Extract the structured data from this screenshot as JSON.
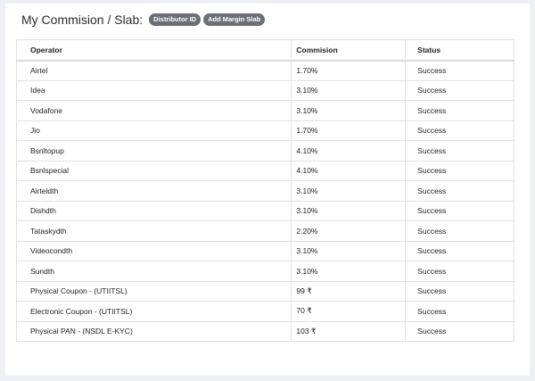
{
  "header": {
    "title": "My Commision / Slab:",
    "badges": [
      "Distributor ID",
      "Add Margin Slab"
    ]
  },
  "table": {
    "columns": [
      "Operator",
      "Commision",
      "Status"
    ],
    "rows": [
      [
        "Airtel",
        "1.70%",
        "Success"
      ],
      [
        "Idea",
        "3.10%",
        "Success"
      ],
      [
        "Vodafone",
        "3.10%",
        "Success"
      ],
      [
        "Jio",
        "1.70%",
        "Success"
      ],
      [
        "Bsnltopup",
        "4.10%",
        "Success"
      ],
      [
        "Bsnlspecial",
        "4.10%",
        "Success"
      ],
      [
        "Airteldth",
        "3.10%",
        "Success"
      ],
      [
        "Dishdth",
        "3.10%",
        "Success"
      ],
      [
        "Tataskydth",
        "2.20%",
        "Success"
      ],
      [
        "Videocondth",
        "3.10%",
        "Success"
      ],
      [
        "Sundth",
        "3.10%",
        "Success"
      ],
      [
        "Physical Coupon - (UTIITSL)",
        "99 ₹",
        "Success"
      ],
      [
        "Electronic Coupon - (UTIITSL)",
        "70 ₹",
        "Success"
      ],
      [
        "Physical PAN - (NSDL E-KYC)",
        "103 ₹",
        "Success"
      ]
    ]
  }
}
